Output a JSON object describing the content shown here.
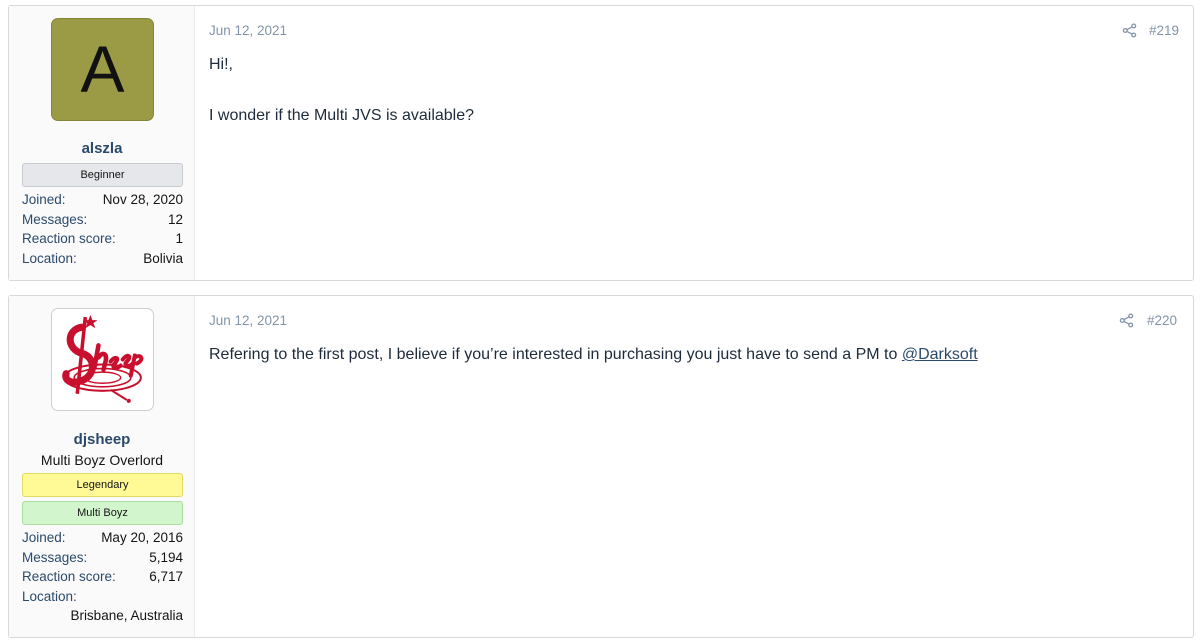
{
  "posts": [
    {
      "avatar_letter": "A",
      "avatar_color": "#9a9b44",
      "username": "alszla",
      "banners": [
        "Beginner"
      ],
      "stats": {
        "joined_label": "Joined:",
        "joined": "Nov 28, 2020",
        "messages_label": "Messages:",
        "messages": "12",
        "reaction_label": "Reaction score:",
        "reaction": "1",
        "location_label": "Location:",
        "location": "Bolivia"
      },
      "date": "Jun 12, 2021",
      "share_icon": "share-icon",
      "number": "#219",
      "message_lines": [
        "Hi!,",
        "I wonder if the Multi JVS is available?"
      ]
    },
    {
      "avatar_alt": "Sheep",
      "username": "djsheep",
      "user_title": "Multi Boyz Overlord",
      "banners": [
        "Legendary",
        "Multi Boyz"
      ],
      "stats": {
        "joined_label": "Joined:",
        "joined": "May 20, 2016",
        "messages_label": "Messages:",
        "messages": "5,194",
        "reaction_label": "Reaction score:",
        "reaction": "6,717",
        "location_label": "Location:",
        "location": "Brisbane, Australia"
      },
      "date": "Jun 12, 2021",
      "share_icon": "share-icon",
      "number": "#220",
      "message_text": "Refering to the first post, I believe if you’re interested in purchasing you just have to send a PM to ",
      "mention": "@Darksoft"
    }
  ],
  "colors": {
    "link": "#2b4a6b",
    "muted": "#8294a9",
    "beginner_banner": "#e5e7ea",
    "legendary_banner": "#fffa96",
    "multiboyz_banner": "#d3f5cd",
    "logo_red": "#c8102e"
  }
}
